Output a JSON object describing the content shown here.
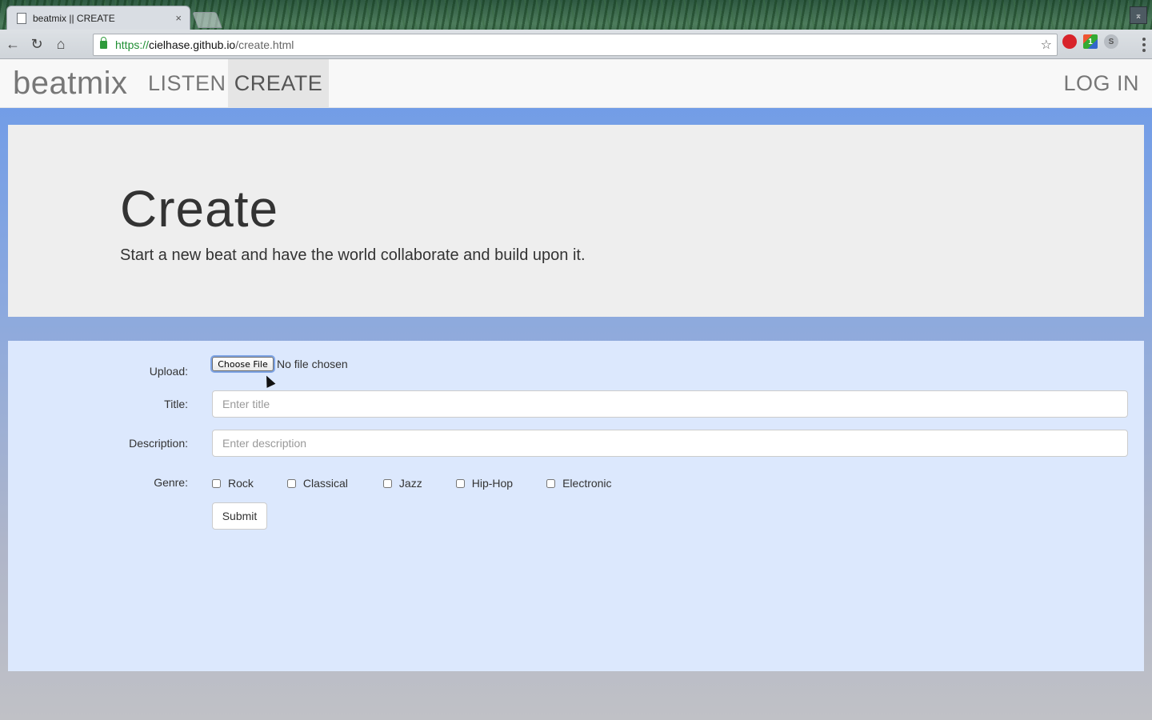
{
  "browser": {
    "tab_title": "beatmix || CREATE",
    "tab_close": "×",
    "url": {
      "scheme": "https://",
      "host": "cielhase.github.io",
      "path": "/create.html"
    },
    "extension_badge": "1"
  },
  "navbar": {
    "brand": "beatmix",
    "links": {
      "listen": "LISTEN",
      "create": "CREATE",
      "login": "LOG IN"
    },
    "active": "create"
  },
  "jumbotron": {
    "title": "Create",
    "subtitle": "Start a new beat and have the world collaborate and build upon it."
  },
  "form": {
    "upload_label": "Upload:",
    "choose_file_label": "Choose File",
    "file_status": "No file chosen",
    "title_label": "Title:",
    "title_placeholder": "Enter title",
    "title_value": "",
    "description_label": "Description:",
    "description_placeholder": "Enter description",
    "description_value": "",
    "genre_label": "Genre:",
    "genres": {
      "rock": "Rock",
      "classical": "Classical",
      "jazz": "Jazz",
      "hiphop": "Hip-Hop",
      "electronic": "Electronic"
    },
    "submit_label": "Submit"
  },
  "colors": {
    "page_gradient_top": "#6c9ae9",
    "jumbotron_bg": "#eeeeee",
    "form_bg": "#dce8fd",
    "navbar_bg": "#f8f8f8"
  }
}
